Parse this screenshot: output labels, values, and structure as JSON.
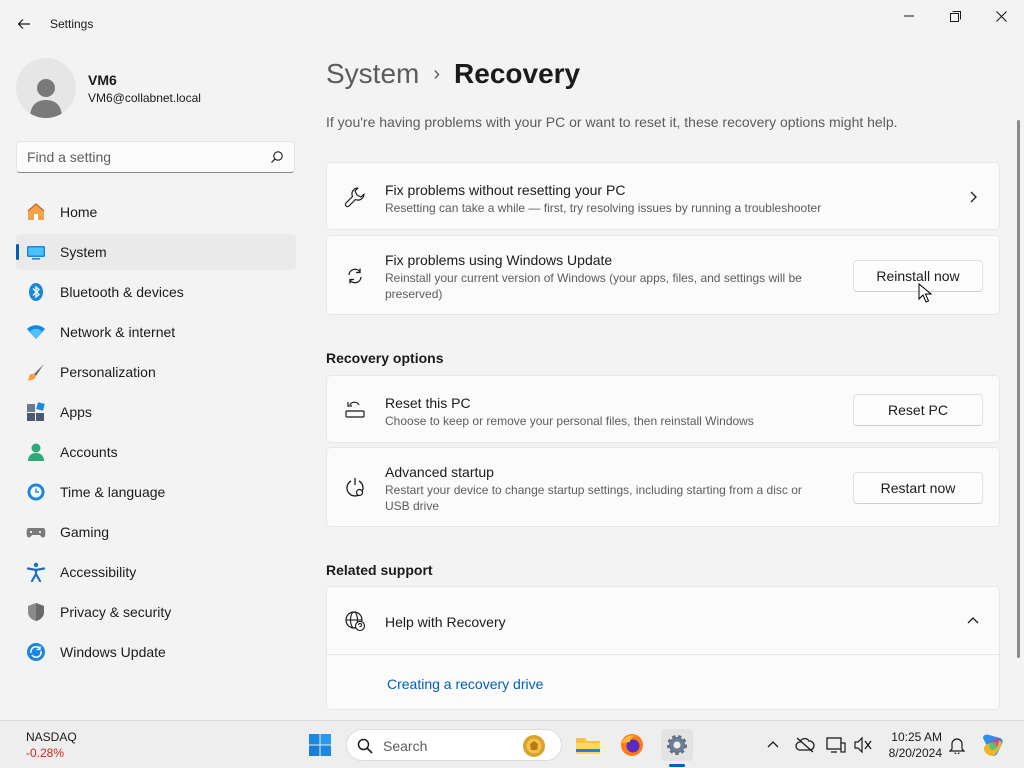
{
  "window": {
    "title": "Settings",
    "back_icon": "arrow-left-icon",
    "controls": [
      "minimize-icon",
      "maximize-icon",
      "close-icon"
    ]
  },
  "user": {
    "name": "VM6",
    "email": "VM6@collabnet.local"
  },
  "search": {
    "placeholder": "Find a setting"
  },
  "nav": {
    "items": [
      {
        "label": "Home",
        "icon": "home-icon"
      },
      {
        "label": "System",
        "icon": "system-display-icon",
        "active": true
      },
      {
        "label": "Bluetooth & devices",
        "icon": "bluetooth-icon"
      },
      {
        "label": "Network & internet",
        "icon": "wifi-icon"
      },
      {
        "label": "Personalization",
        "icon": "brush-icon"
      },
      {
        "label": "Apps",
        "icon": "apps-icon"
      },
      {
        "label": "Accounts",
        "icon": "accounts-icon"
      },
      {
        "label": "Time & language",
        "icon": "globe-clock-icon"
      },
      {
        "label": "Gaming",
        "icon": "gamepad-icon"
      },
      {
        "label": "Accessibility",
        "icon": "accessibility-icon"
      },
      {
        "label": "Privacy & security",
        "icon": "shield-icon"
      },
      {
        "label": "Windows Update",
        "icon": "windows-update-icon"
      }
    ]
  },
  "breadcrumb": {
    "parent": "System",
    "separator": "›",
    "current": "Recovery"
  },
  "intro": "If you're having problems with your PC or want to reset it, these recovery options might help.",
  "cards": {
    "fix_without_reset": {
      "title": "Fix problems without resetting your PC",
      "desc": "Resetting can take a while — first, try resolving issues by running a troubleshooter",
      "icon": "wrench-icon"
    },
    "fix_windows_update": {
      "title": "Fix problems using Windows Update",
      "desc": "Reinstall your current version of Windows (your apps, files, and settings will be preserved)",
      "button": "Reinstall now",
      "icon": "sync-icon"
    }
  },
  "recovery_options": {
    "heading": "Recovery options",
    "reset": {
      "title": "Reset this PC",
      "desc": "Choose to keep or remove your personal files, then reinstall Windows",
      "button": "Reset PC",
      "icon": "reset-pc-icon"
    },
    "advanced": {
      "title": "Advanced startup",
      "desc": "Restart your device to change startup settings, including starting from a disc or USB drive",
      "button": "Restart now",
      "icon": "advanced-startup-icon"
    }
  },
  "related_support": {
    "heading": "Related support",
    "help": {
      "title": "Help with Recovery",
      "icon": "globe-help-icon"
    },
    "link": "Creating a recovery drive"
  },
  "taskbar": {
    "widget": {
      "name": "NASDAQ",
      "value": "-0.28%"
    },
    "search_label": "Search",
    "time": "10:25 AM",
    "date": "8/20/2024"
  },
  "colors": {
    "accent": "#005fb8",
    "negative": "#c42b1c"
  }
}
